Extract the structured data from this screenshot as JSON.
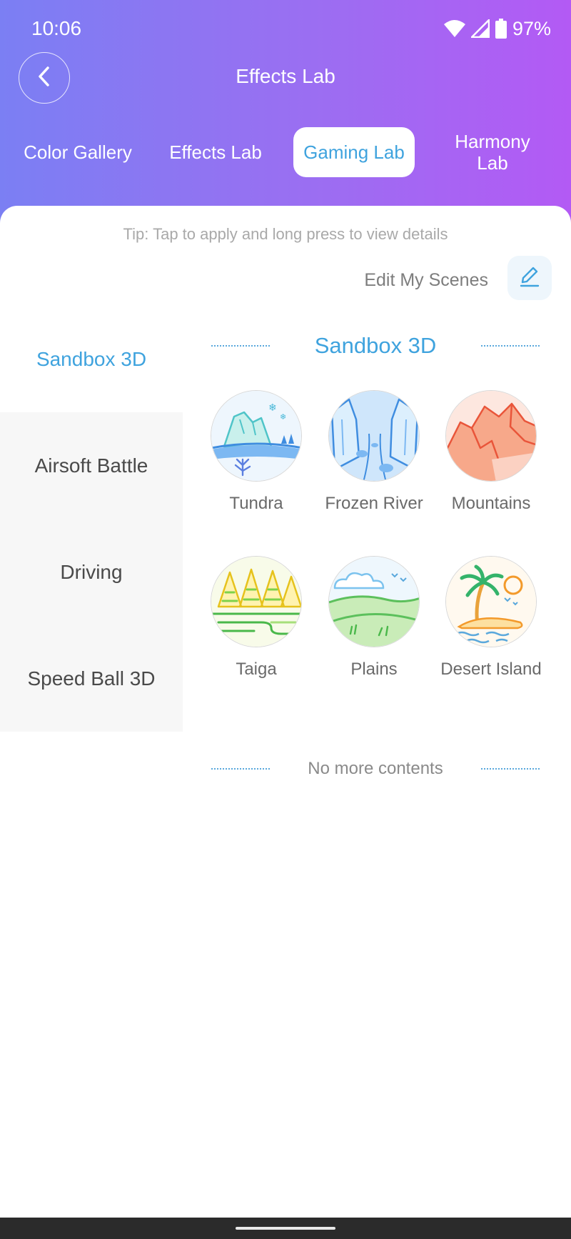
{
  "status": {
    "time": "10:06",
    "battery": "97%"
  },
  "header": {
    "title": "Effects Lab"
  },
  "tabs": [
    {
      "label": "Color Gallery",
      "active": false
    },
    {
      "label": "Effects Lab",
      "active": false
    },
    {
      "label": "Gaming Lab",
      "active": true
    },
    {
      "label": "Harmony Lab",
      "active": false
    }
  ],
  "tip": "Tip: Tap to apply and long press to view details",
  "edit": {
    "label": "Edit My Scenes"
  },
  "sidebar": {
    "items": [
      {
        "label": "Sandbox 3D",
        "active": true
      },
      {
        "label": "Airsoft Battle",
        "active": false
      },
      {
        "label": "Driving",
        "active": false
      },
      {
        "label": "Speed Ball 3D",
        "active": false
      }
    ]
  },
  "section": {
    "title": "Sandbox 3D"
  },
  "scenes": [
    {
      "label": "Tundra",
      "icon": "tundra-icon"
    },
    {
      "label": "Frozen River",
      "icon": "frozen-river-icon"
    },
    {
      "label": "Mountains",
      "icon": "mountains-icon"
    },
    {
      "label": "Taiga",
      "icon": "taiga-icon"
    },
    {
      "label": "Plains",
      "icon": "plains-icon"
    },
    {
      "label": "Desert Island",
      "icon": "desert-island-icon"
    }
  ],
  "end_note": "No more contents",
  "colors": {
    "accent": "#3fa3de",
    "gradient_start": "#7b7ff3",
    "gradient_end": "#b35af4"
  }
}
